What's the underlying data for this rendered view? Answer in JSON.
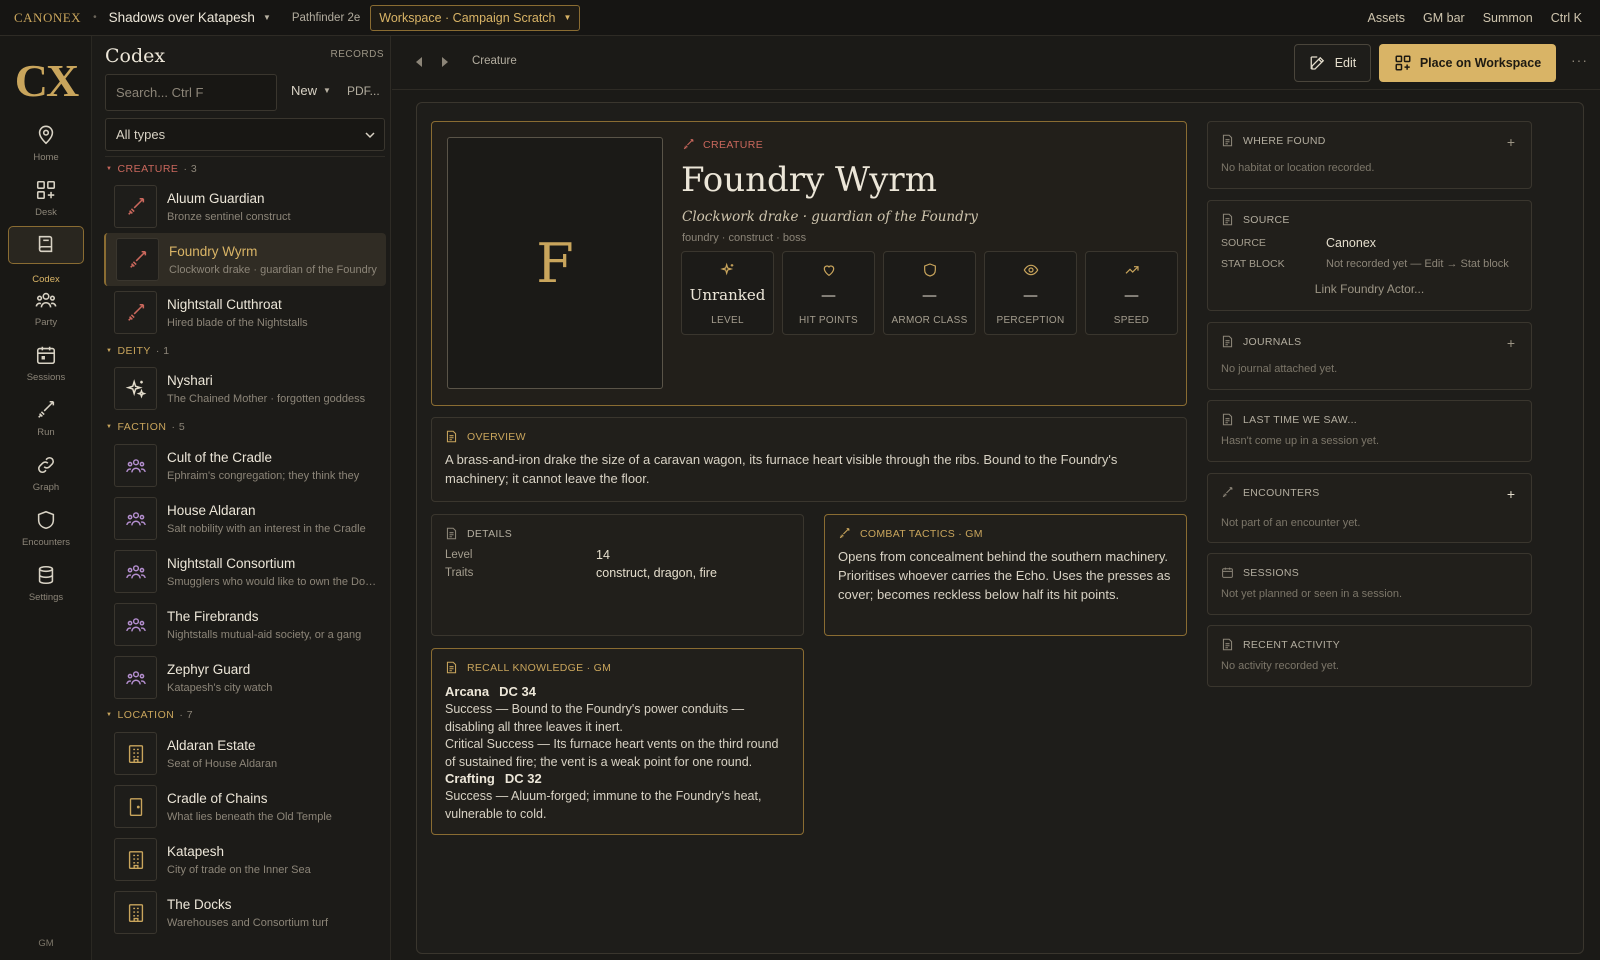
{
  "topbar": {
    "brand": "CANONEX",
    "campaign": "Shadows over Katapesh",
    "system": "Pathfinder 2e",
    "workspace": "Workspace · Campaign Scratch",
    "links": [
      "Assets",
      "GM bar",
      "Summon",
      "Ctrl K"
    ]
  },
  "rail": {
    "logo": "CX",
    "items": [
      {
        "label": "Home",
        "icon": "map-pin-icon"
      },
      {
        "label": "Desk",
        "icon": "grid-plus-icon"
      },
      {
        "label": "Codex",
        "icon": "book-icon"
      },
      {
        "label": "Party",
        "icon": "people-icon"
      },
      {
        "label": "Sessions",
        "icon": "calendar-icon"
      },
      {
        "label": "Run",
        "icon": "sword-icon"
      },
      {
        "label": "Graph",
        "icon": "link-icon"
      },
      {
        "label": "Encounters",
        "icon": "shield-icon"
      },
      {
        "label": "Settings",
        "icon": "database-icon"
      }
    ],
    "gm": "GM"
  },
  "codex": {
    "title": "Codex",
    "records_label": "RECORDS",
    "search_placeholder": "Search...  Ctrl F",
    "new_label": "New",
    "pdf_label": "PDF...",
    "type_filter": "All types",
    "groups": {
      "creature": {
        "label": "CREATURE",
        "count": "3"
      },
      "deity": {
        "label": "DEITY",
        "count": "1"
      },
      "faction": {
        "label": "FACTION",
        "count": "5"
      },
      "location": {
        "label": "LOCATION",
        "count": "7"
      }
    },
    "items": [
      {
        "name": "Aluum Guardian",
        "sub": "Bronze sentinel construct"
      },
      {
        "name": "Foundry Wyrm",
        "sub": "Clockwork drake · guardian of the Foundry"
      },
      {
        "name": "Nightstall Cutthroat",
        "sub": "Hired blade of the Nightstalls"
      },
      {
        "name": "Nyshari",
        "sub": "The Chained Mother · forgotten goddess"
      },
      {
        "name": "Cult of the Cradle",
        "sub": "Ephraim's congregation; they think they"
      },
      {
        "name": "House Aldaran",
        "sub": "Salt nobility with an interest in the Cradle"
      },
      {
        "name": "Nightstall Consortium",
        "sub": "Smugglers who would like to own the Docks"
      },
      {
        "name": "The Firebrands",
        "sub": "Nightstalls mutual-aid society, or a gang"
      },
      {
        "name": "Zephyr Guard",
        "sub": "Katapesh's city watch"
      },
      {
        "name": "Aldaran Estate",
        "sub": "Seat of House Aldaran"
      },
      {
        "name": "Cradle of Chains",
        "sub": "What lies beneath the Old Temple"
      },
      {
        "name": "Katapesh",
        "sub": "City of trade on the Inner Sea"
      },
      {
        "name": "The Docks",
        "sub": "Warehouses and Consortium turf"
      }
    ]
  },
  "main": {
    "breadcrumb": "Creature",
    "edit_label": "Edit",
    "place_label": "Place on Workspace",
    "more_label": "···",
    "record": {
      "portrait_letter": "F",
      "kind": "CREATURE",
      "name": "Foundry Wyrm",
      "tagline": "Clockwork drake · guardian of the Foundry",
      "keywords": "foundry · construct · boss",
      "stats": [
        {
          "value": "Unranked",
          "label": "LEVEL"
        },
        {
          "value": "—",
          "label": "HIT POINTS"
        },
        {
          "value": "—",
          "label": "ARMOR CLASS"
        },
        {
          "value": "—",
          "label": "PERCEPTION"
        },
        {
          "value": "—",
          "label": "SPEED"
        }
      ]
    },
    "overview": {
      "heading": "OVERVIEW",
      "text": "A brass-and-iron drake the size of a caravan wagon, its furnace heart visible through the ribs. Bound to the Foundry's machinery; it cannot leave the floor."
    },
    "details": {
      "heading": "DETAILS",
      "rows": [
        {
          "key": "Level",
          "value": "14"
        },
        {
          "key": "Traits",
          "value": "construct, dragon, fire"
        }
      ]
    },
    "combat": {
      "heading": "COMBAT TACTICS · GM",
      "text": "Opens from concealment behind the southern machinery. Prioritises whoever carries the Echo. Uses the presses as cover; becomes reckless below half its hit points."
    },
    "recall": {
      "heading": "RECALL KNOWLEDGE · GM",
      "arcana_skill": "Arcana",
      "arcana_dc": "DC 34",
      "arcana_lines": [
        "Success — Bound to the Foundry's power conduits — disabling all three leaves it inert.",
        "Critical Success — Its furnace heart vents on the third round of sustained fire; the vent is a weak point for one round."
      ],
      "crafting_skill": "Crafting",
      "crafting_dc": "DC 32",
      "crafting_lines": [
        "Success — Aluum-forged; immune to the Foundry's heat, vulnerable to cold."
      ]
    },
    "side": {
      "where_found": {
        "heading": "WHERE FOUND",
        "plus": "+",
        "empty": "No habitat or location recorded."
      },
      "source": {
        "heading": "SOURCE",
        "source_key": "SOURCE",
        "source_value": "Canonex",
        "stat_key": "STAT BLOCK",
        "stat_value": "Not recorded yet — Edit → Stat block",
        "link": "Link Foundry Actor..."
      },
      "journals": {
        "heading": "JOURNALS",
        "plus": "+",
        "empty": "No journal attached yet."
      },
      "last_time": {
        "heading": "LAST TIME WE SAW...",
        "empty": "Hasn't come up in a session yet."
      },
      "encounters": {
        "heading": "ENCOUNTERS",
        "plus": "+",
        "empty": "Not part of an encounter yet."
      },
      "sessions": {
        "heading": "SESSIONS",
        "empty": "Not yet planned or seen in a session."
      },
      "recent": {
        "heading": "RECENT ACTIVITY",
        "empty": "No activity recorded yet."
      }
    }
  },
  "colors": {
    "accent": "#d9b466",
    "creature": "#c9675c",
    "faction": "#b58fd0",
    "background": "#1b1a17"
  }
}
